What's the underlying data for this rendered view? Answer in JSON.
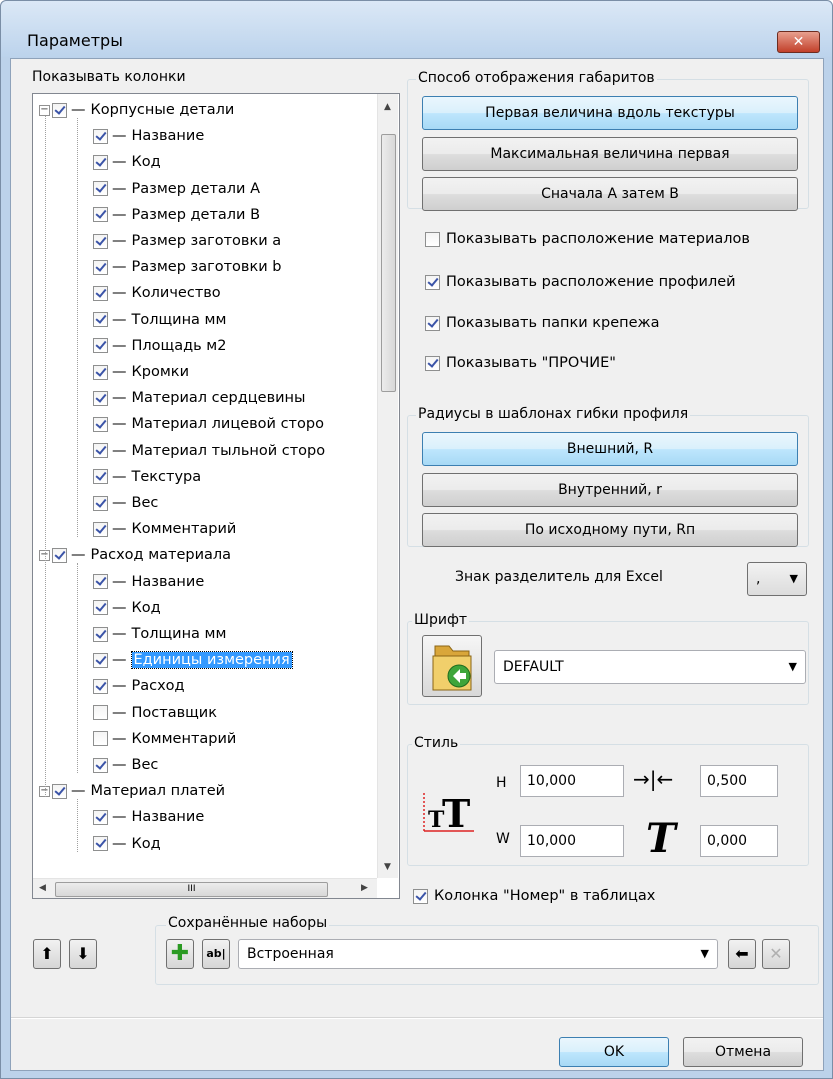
{
  "window": {
    "title": "Параметры",
    "close_glyph": "✕"
  },
  "columns_label": "Показывать колонки",
  "tree": [
    {
      "level": 0,
      "label": "Корпусные детали",
      "checked": true
    },
    {
      "level": 1,
      "label": "Название",
      "checked": true
    },
    {
      "level": 1,
      "label": "Код",
      "checked": true
    },
    {
      "level": 1,
      "label": "Размер детали A",
      "checked": true
    },
    {
      "level": 1,
      "label": "Размер детали B",
      "checked": true
    },
    {
      "level": 1,
      "label": "Размер заготовки a",
      "checked": true
    },
    {
      "level": 1,
      "label": "Размер заготовки b",
      "checked": true
    },
    {
      "level": 1,
      "label": "Количество",
      "checked": true
    },
    {
      "level": 1,
      "label": "Толщина мм",
      "checked": true
    },
    {
      "level": 1,
      "label": "Площадь м2",
      "checked": true
    },
    {
      "level": 1,
      "label": "Кромки",
      "checked": true
    },
    {
      "level": 1,
      "label": "Материал сердцевины",
      "checked": true
    },
    {
      "level": 1,
      "label": "Материал лицевой сторо",
      "checked": true
    },
    {
      "level": 1,
      "label": "Материал тыльной сторо",
      "checked": true
    },
    {
      "level": 1,
      "label": "Текстура",
      "checked": true
    },
    {
      "level": 1,
      "label": "Вес",
      "checked": true
    },
    {
      "level": 1,
      "label": "Комментарий",
      "checked": true
    },
    {
      "level": 0,
      "label": "Расход материала",
      "checked": true
    },
    {
      "level": 1,
      "label": "Название",
      "checked": true
    },
    {
      "level": 1,
      "label": "Код",
      "checked": true
    },
    {
      "level": 1,
      "label": "Толщина мм",
      "checked": true
    },
    {
      "level": 1,
      "label": "Единицы измерения",
      "checked": true,
      "selected": true
    },
    {
      "level": 1,
      "label": "Расход",
      "checked": true
    },
    {
      "level": 1,
      "label": "Поставщик",
      "checked": false
    },
    {
      "level": 1,
      "label": "Комментарий",
      "checked": false
    },
    {
      "level": 1,
      "label": "Вес",
      "checked": true
    },
    {
      "level": 0,
      "label": "Материал платей",
      "checked": true
    },
    {
      "level": 1,
      "label": "Название",
      "checked": true
    },
    {
      "level": 1,
      "label": "Код",
      "checked": true
    }
  ],
  "scroll_grip": "III",
  "dimensions_group": {
    "label": "Способ отображения габаритов",
    "buttons": [
      "Первая величина вдоль текстуры",
      "Максимальная величина первая",
      "Сначала A затем B"
    ],
    "active_index": 0
  },
  "checks": [
    {
      "label": "Показывать расположение материалов",
      "checked": false
    },
    {
      "label": "Показывать расположение профилей",
      "checked": true
    },
    {
      "label": "Показывать папки крепежа",
      "checked": true
    },
    {
      "label": "Показывать \"ПРОЧИЕ\"",
      "checked": true
    }
  ],
  "radius_group": {
    "label": "Радиусы в шаблонах гибки профиля",
    "buttons": [
      "Внешний, R",
      "Внутренний, r",
      "По исходному пути, Rп"
    ],
    "active_index": 0
  },
  "excel": {
    "label": "Знак разделитель для Excel",
    "value": ","
  },
  "font_group": {
    "label": "Шрифт",
    "value": "DEFAULT"
  },
  "style_group": {
    "label": "Стиль",
    "h_label": "H",
    "h_value": "10,000",
    "w_label": "W",
    "w_value": "10,000",
    "spacing_value": "0,500",
    "slant_value": "0,000"
  },
  "number_column": {
    "label": "Колонка \"Номер\" в таблицах",
    "checked": true
  },
  "saved_sets": {
    "label": "Сохранённые наборы",
    "value": "Встроенная"
  },
  "footer": {
    "ok": "OK",
    "cancel": "Отмена"
  },
  "colors": {
    "accent": "#3399ff",
    "title_bg": "#bcd2ea",
    "close": "#c2402a"
  }
}
